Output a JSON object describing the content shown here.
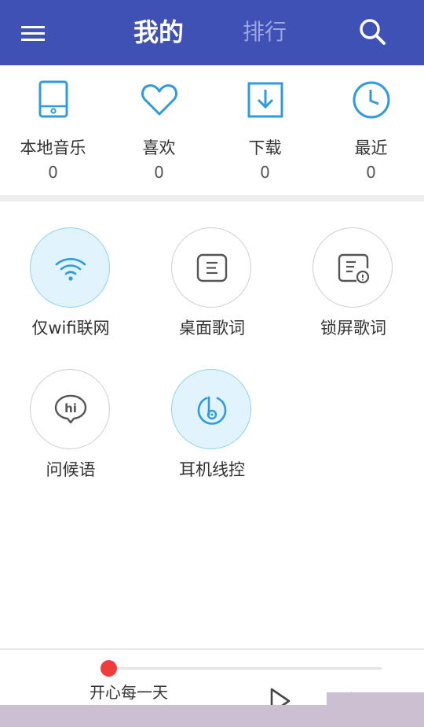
{
  "header": {
    "tab_mine": "我的",
    "tab_rank": "排行",
    "menu_icon": "menu-icon",
    "search_icon": "search-icon",
    "bar_color": "#3f51b5"
  },
  "quick_entries": [
    {
      "icon": "tablet-icon",
      "label": "本地音乐",
      "count": "0"
    },
    {
      "icon": "heart-icon",
      "label": "喜欢",
      "count": "0"
    },
    {
      "icon": "download-icon",
      "label": "下载",
      "count": "0"
    },
    {
      "icon": "clock-icon",
      "label": "最近",
      "count": "0"
    }
  ],
  "settings": [
    {
      "icon": "wifi-icon",
      "label": "仅wifi联网",
      "active": true
    },
    {
      "icon": "lyrics-icon",
      "label": "桌面歌词",
      "active": false
    },
    {
      "icon": "lockscreen-lyrics-icon",
      "label": "锁屏歌词",
      "active": false
    },
    {
      "icon": "hi-chat-icon",
      "label": "问候语",
      "active": false
    },
    {
      "icon": "headset-control-icon",
      "label": "耳机线控",
      "active": true
    }
  ],
  "player": {
    "song_title": "开心每一天",
    "progress": 0,
    "play_icon": "play-icon",
    "accent": "#f23c3c"
  },
  "colors": {
    "accent_blue": "#2e9be0",
    "active_circle_bg": "#e1f3fd"
  }
}
